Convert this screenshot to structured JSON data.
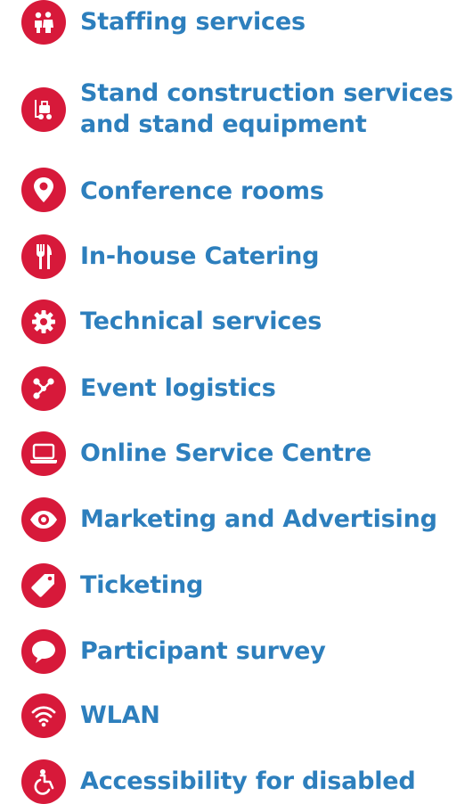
{
  "services": [
    {
      "label": "Staffing services",
      "icon": "people-icon"
    },
    {
      "label": "Stand construction services",
      "label2": "and stand equipment",
      "icon": "forklift-icon"
    },
    {
      "label": "Conference rooms",
      "icon": "map-pin-icon"
    },
    {
      "label": "In-house Catering",
      "icon": "cutlery-icon"
    },
    {
      "label": "Technical services",
      "icon": "gear-icon"
    },
    {
      "label": "Event logistics",
      "icon": "network-icon"
    },
    {
      "label": "Online Service Centre",
      "icon": "laptop-icon"
    },
    {
      "label": "Marketing and Advertising",
      "icon": "eye-icon"
    },
    {
      "label": "Ticketing",
      "icon": "tag-icon"
    },
    {
      "label": "Participant survey",
      "icon": "speech-bubble-icon"
    },
    {
      "label": "WLAN",
      "icon": "wifi-icon"
    },
    {
      "label": "Accessibility for disabled",
      "icon": "wheelchair-icon"
    }
  ],
  "colors": {
    "icon_bg": "#d7193a",
    "link_text": "#2d7fbd"
  }
}
